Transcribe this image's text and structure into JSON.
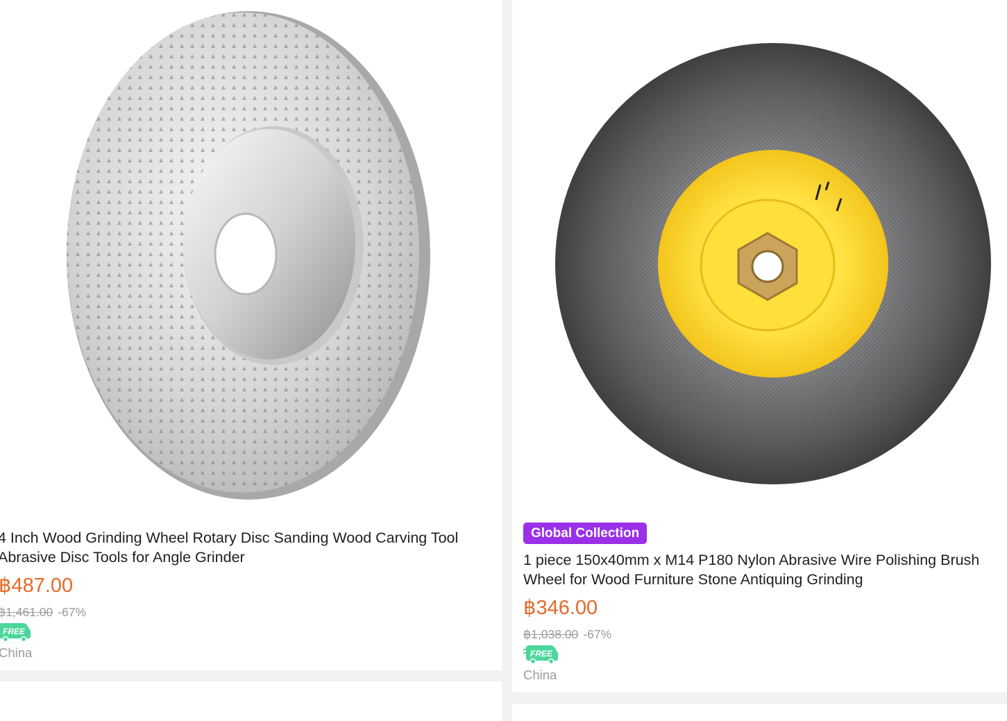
{
  "products": [
    {
      "title": "4 Inch Wood Grinding Wheel Rotary Disc Sanding Wood Carving Tool Abrasive Disc Tools for Angle Grinder",
      "price": "฿487.00",
      "original_price": "฿1,461.00",
      "discount": "-67%",
      "shipping_badge": "FREE",
      "origin": "China",
      "image_icon": "carving-disc-image"
    },
    {
      "tag": "Global Collection",
      "title": "1 piece 150x40mm x M14 P180 Nylon Abrasive Wire Polishing Brush Wheel for Wood Furniture Stone Antiquing Grinding",
      "price": "฿346.00",
      "original_price": "฿1,038.00",
      "discount": "-67%",
      "shipping_badge": "FREE",
      "origin": "China",
      "image_icon": "brush-wheel-image"
    }
  ],
  "colors": {
    "price": "#e56a2a",
    "tag_background": "#9b30e8",
    "free_badge": "#4cd69c",
    "muted_text": "#9b9b9b",
    "background": "#f2f2f4"
  }
}
